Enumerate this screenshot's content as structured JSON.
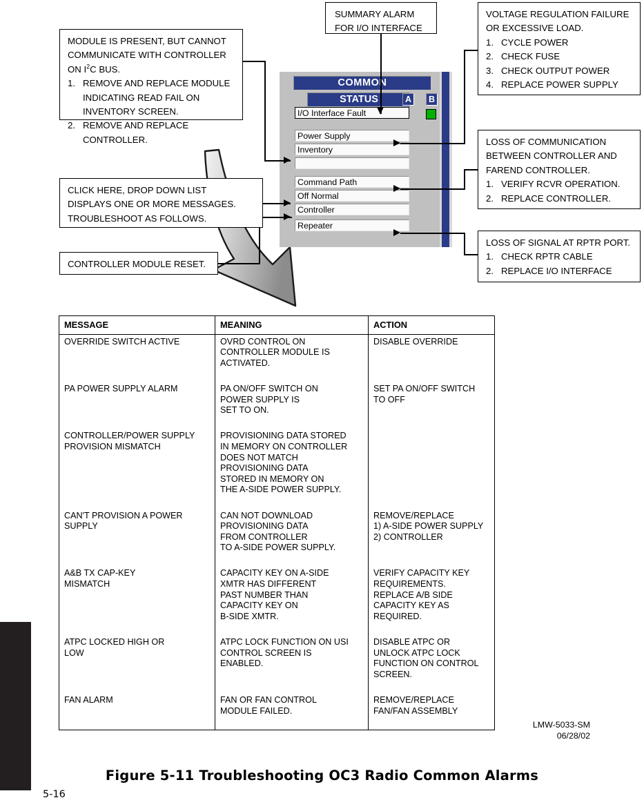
{
  "callouts": {
    "module_present": {
      "id": "module-present-callout",
      "lines": [
        {
          "text": "MODULE IS PRESENT, BUT CANNOT"
        },
        {
          "text": "COMMUNICATE WITH CONTROLLER"
        },
        {
          "text": "ON I2C BUS.",
          "super": "2"
        },
        {
          "num": "1.",
          "text": "REMOVE AND REPLACE MODULE"
        },
        {
          "indent": true,
          "text": "INDICATING READ FAIL ON"
        },
        {
          "indent": true,
          "text": "INVENTORY SCREEN."
        },
        {
          "num": "2.",
          "text": "REMOVE AND REPLACE"
        },
        {
          "indent": true,
          "text": "CONTROLLER."
        }
      ]
    },
    "summary_alarm": {
      "id": "summary-alarm-callout",
      "lines": [
        {
          "text": "SUMMARY ALARM"
        },
        {
          "text": "FOR I/O INTERFACE"
        }
      ]
    },
    "voltage_regulation": {
      "id": "voltage-regulation-callout",
      "lines": [
        {
          "text": "VOLTAGE REGULATION FAILURE"
        },
        {
          "text": "OR EXCESSIVE LOAD."
        },
        {
          "num": "1.",
          "text": "CYCLE POWER"
        },
        {
          "num": "2.",
          "text": "CHECK FUSE"
        },
        {
          "num": "3.",
          "text": "CHECK OUTPUT POWER"
        },
        {
          "num": "4.",
          "text": "REPLACE POWER SUPPLY"
        }
      ]
    },
    "loss_communication": {
      "id": "loss-communication-callout",
      "lines": [
        {
          "text": "LOSS OF COMMUNICATION"
        },
        {
          "text": "BETWEEN CONTROLLER AND"
        },
        {
          "text": "FAREND CONTROLLER."
        },
        {
          "num": "1.",
          "text": "VERIFY RCVR OPERATION."
        },
        {
          "num": "2.",
          "text": "REPLACE CONTROLLER."
        }
      ]
    },
    "click_here": {
      "id": "click-here-callout",
      "lines": [
        {
          "text": "CLICK HERE, DROP DOWN LIST"
        },
        {
          "text": "DISPLAYS ONE OR MORE MESSAGES."
        },
        {
          "text": "TROUBLESHOOT AS FOLLOWS."
        }
      ]
    },
    "loss_signal": {
      "id": "loss-signal-callout",
      "lines": [
        {
          "text": "LOSS OF SIGNAL AT RPTR PORT."
        },
        {
          "num": "1.",
          "text": "CHECK RPTR CABLE"
        },
        {
          "num": "2.",
          "text": "REPLACE I/O INTERFACE"
        }
      ]
    },
    "controller_reset": {
      "id": "controller-reset-callout",
      "lines": [
        {
          "text": "CONTROLLER MODULE RESET."
        }
      ]
    }
  },
  "app_panel": {
    "title": "COMMON",
    "status_header": "STATUS",
    "badge_a": "A",
    "badge_b": "B",
    "fault_value": "I/O Interface Fault",
    "led_color": "#00b000",
    "accent_color": "#2a3b87",
    "rows": [
      {
        "label": "Power Supply"
      },
      {
        "label": "Inventory"
      },
      {
        "label": ""
      },
      {
        "label": "Command Path"
      },
      {
        "label": "Off Normal"
      },
      {
        "label": "Controller"
      },
      {
        "label": "Repeater"
      }
    ]
  },
  "table": {
    "headers": [
      "MESSAGE",
      "MEANING",
      "ACTION"
    ],
    "rows": [
      {
        "message": [
          "OVERRIDE SWITCH ACTIVE"
        ],
        "meaning": [
          "OVRD CONTROL ON",
          "CONTROLLER MODULE IS",
          "ACTIVATED."
        ],
        "action": [
          "DISABLE OVERRIDE"
        ]
      },
      {
        "message": [
          "PA POWER SUPPLY ALARM"
        ],
        "meaning": [
          "PA ON/OFF SWITCH ON",
          "POWER SUPPLY IS",
          "SET TO ON."
        ],
        "action": [
          "SET PA ON/OFF SWITCH",
          "TO OFF"
        ]
      },
      {
        "message": [
          "CONTROLLER/POWER SUPPLY",
          "PROVISION MISMATCH"
        ],
        "meaning": [
          "PROVISIONING DATA STORED",
          "IN MEMORY ON CONTROLLER",
          "DOES NOT MATCH",
          "PROVISIONING DATA",
          "STORED IN MEMORY ON",
          "THE A-SIDE POWER SUPPLY."
        ],
        "action": []
      },
      {
        "message": [
          "CAN'T PROVISION A POWER",
          "SUPPLY"
        ],
        "meaning": [
          "CAN NOT DOWNLOAD",
          "PROVISIONING DATA",
          "FROM CONTROLLER",
          "TO A-SIDE POWER SUPPLY."
        ],
        "action": [
          "REMOVE/REPLACE",
          "1) A-SIDE POWER SUPPLY",
          "2) CONTROLLER"
        ]
      },
      {
        "message": [
          "A&B TX CAP-KEY",
          "MISMATCH"
        ],
        "meaning": [
          "CAPACITY KEY ON A-SIDE",
          "XMTR HAS DIFFERENT",
          "PAST NUMBER THAN",
          "CAPACITY KEY ON",
          "B-SIDE XMTR."
        ],
        "action": [
          "VERIFY CAPACITY KEY",
          "REQUIREMENTS.",
          "REPLACE A/B SIDE",
          "CAPACITY KEY AS",
          "REQUIRED."
        ]
      },
      {
        "message": [
          "ATPC LOCKED HIGH OR",
          "LOW"
        ],
        "meaning": [
          "ATPC LOCK FUNCTION ON USI",
          "CONTROL SCREEN IS",
          "ENABLED."
        ],
        "action": [
          "DISABLE ATPC OR",
          "UNLOCK ATPC LOCK",
          "FUNCTION ON CONTROL",
          "SCREEN."
        ]
      },
      {
        "message": [
          "FAN ALARM"
        ],
        "meaning": [
          "FAN OR FAN CONTROL",
          "MODULE FAILED."
        ],
        "action": [
          "REMOVE/REPLACE",
          "FAN/FAN ASSEMBLY"
        ]
      }
    ]
  },
  "document": {
    "doc_code": "LMW-5033-SM",
    "doc_date": "06/28/02",
    "figure_caption": "Figure 5-11  Troubleshooting OC3 Radio Common Alarms",
    "page_number": "5-16"
  }
}
